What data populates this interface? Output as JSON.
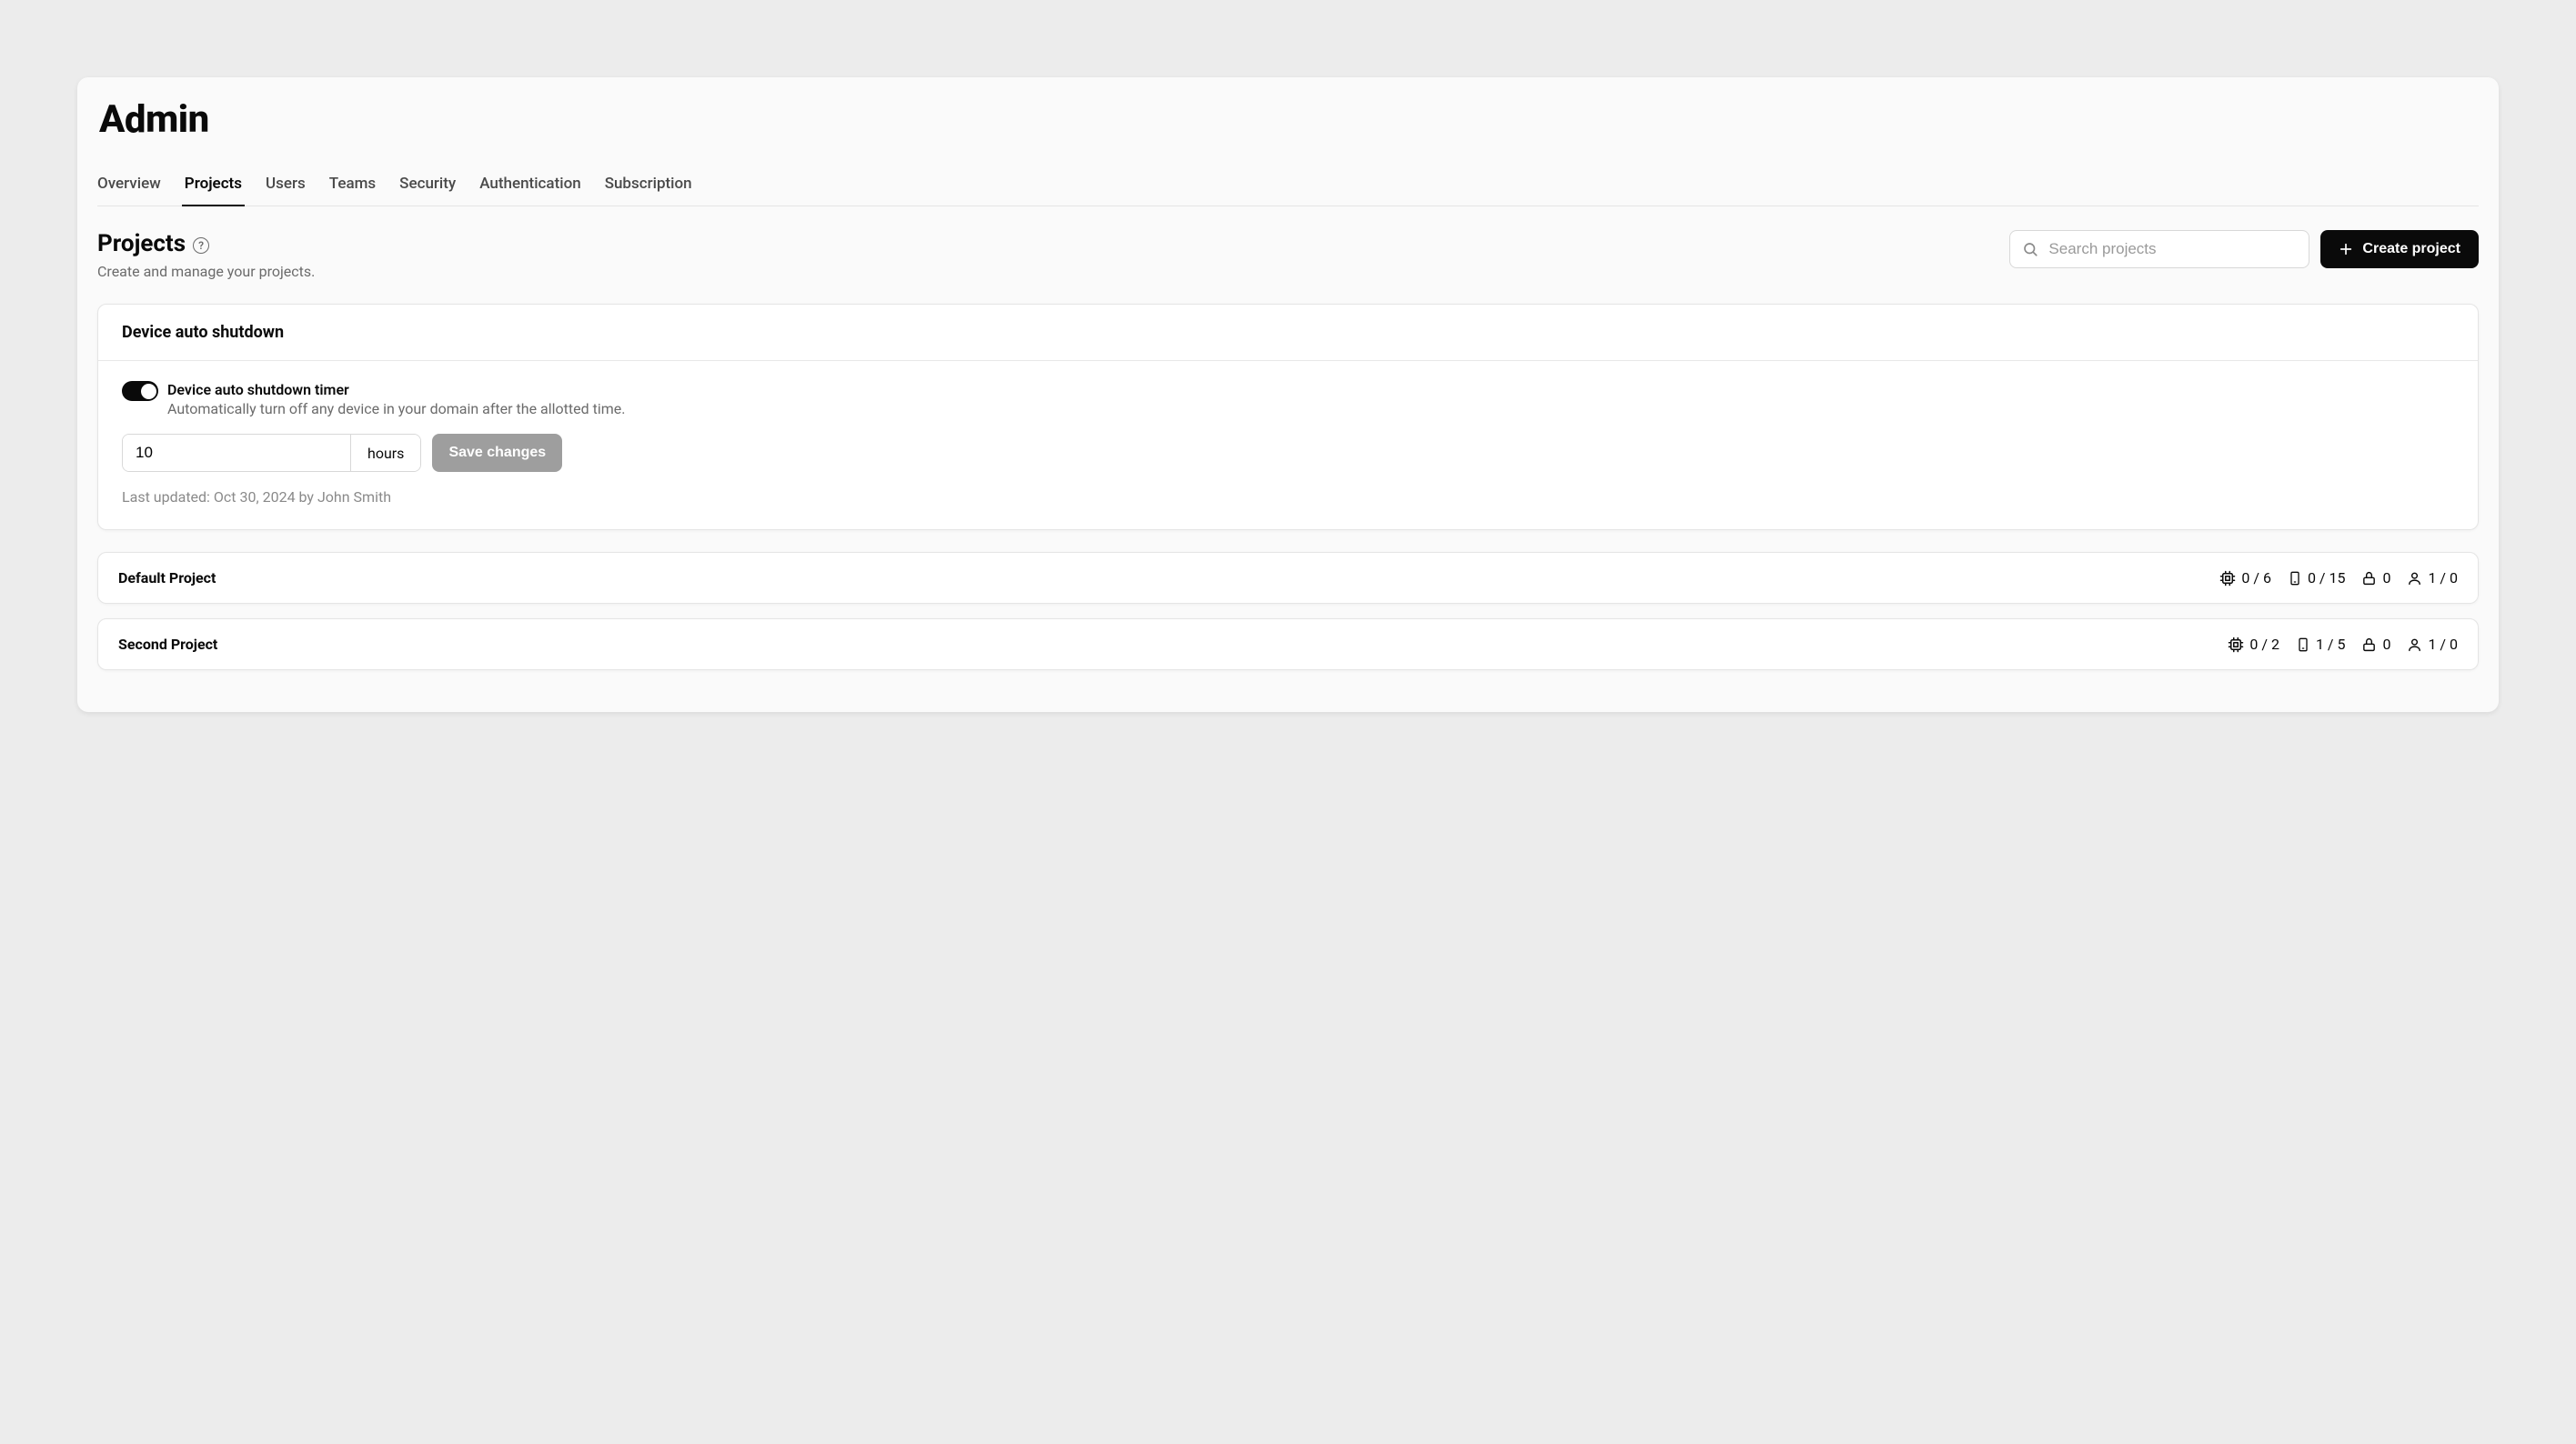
{
  "page_title": "Admin",
  "tabs": [
    {
      "label": "Overview",
      "active": false
    },
    {
      "label": "Projects",
      "active": true
    },
    {
      "label": "Users",
      "active": false
    },
    {
      "label": "Teams",
      "active": false
    },
    {
      "label": "Security",
      "active": false
    },
    {
      "label": "Authentication",
      "active": false
    },
    {
      "label": "Subscription",
      "active": false
    }
  ],
  "section": {
    "title": "Projects",
    "subtitle": "Create and manage your projects."
  },
  "search": {
    "placeholder": "Search projects",
    "value": ""
  },
  "create_button": "Create project",
  "shutdown_card": {
    "title": "Device auto shutdown",
    "toggle_label": "Device auto shutdown timer",
    "toggle_desc": "Automatically turn off any device in your domain after the allotted time.",
    "value": "10",
    "unit": "hours",
    "save_label": "Save changes",
    "last_updated": "Last updated: Oct 30, 2024 by John Smith"
  },
  "projects": [
    {
      "name": "Default Project",
      "cpu": "0 / 6",
      "devices": "0 / 15",
      "snapshots": "0",
      "users": "1 / 0"
    },
    {
      "name": "Second Project",
      "cpu": "0 / 2",
      "devices": "1 / 5",
      "snapshots": "0",
      "users": "1 / 0"
    }
  ]
}
